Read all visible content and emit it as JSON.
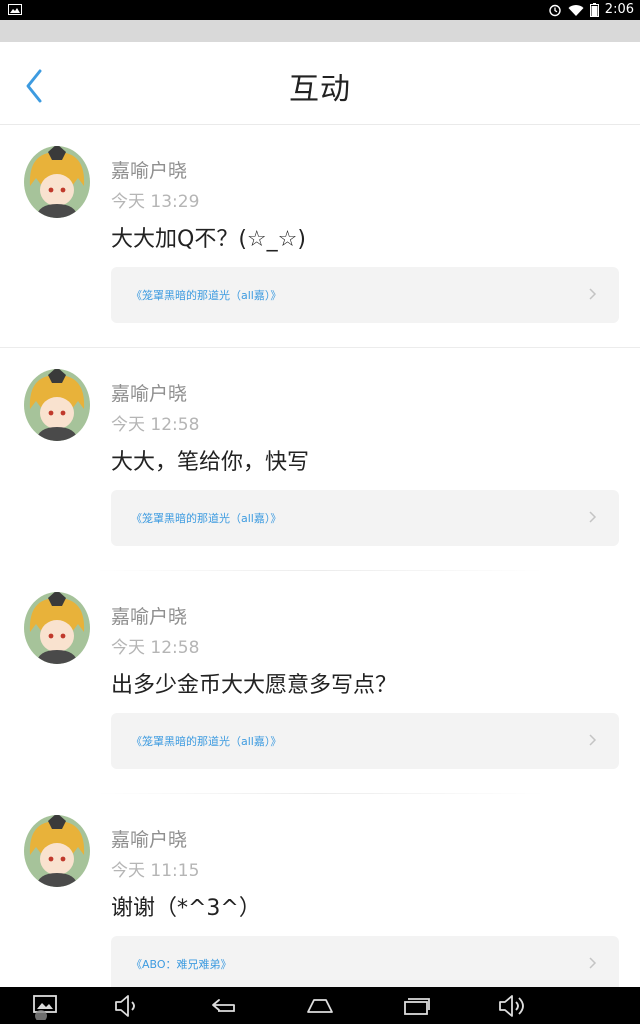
{
  "status_bar": {
    "time": "2:06"
  },
  "header": {
    "title": "互动"
  },
  "items": [
    {
      "name": "嘉喻户晓",
      "time": "今天 13:29",
      "message": "大大加Q不？(☆_☆)",
      "ref": "《笼罩黑暗的那道光（all嘉）》"
    },
    {
      "name": "嘉喻户晓",
      "time": "今天 12:58",
      "message": "大大，笔给你，快写",
      "ref": "《笼罩黑暗的那道光（all嘉）》"
    },
    {
      "name": "嘉喻户晓",
      "time": "今天 12:58",
      "message": "出多少金币大大愿意多写点？",
      "ref": "《笼罩黑暗的那道光（all嘉）》"
    },
    {
      "name": "嘉喻户晓",
      "time": "今天 11:15",
      "message": "谢谢（*^3^）",
      "ref": "《ABO：难兄难弟》"
    }
  ],
  "colors": {
    "accent": "#3d9be0",
    "title": "#222222",
    "name": "#8f8f8f",
    "time": "#b5b5b5",
    "card": "#f3f3f3"
  }
}
